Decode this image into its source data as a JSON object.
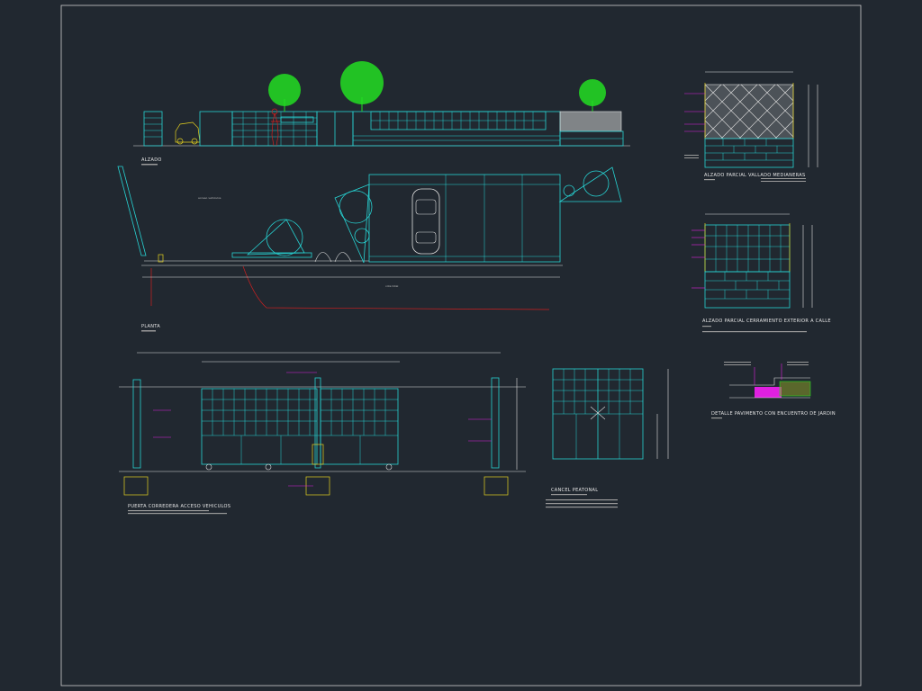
{
  "colors": {
    "background": "#212830",
    "cyan": "#27d3d3",
    "white": "#e0e0e0",
    "magenta": "#e020e0",
    "yellow": "#e6d21e",
    "red": "#d02020",
    "green": "#22dd22"
  },
  "titles": {
    "alzado": "ALZADO",
    "planta": "PLANTA",
    "puerta": "PUERTA CORREDERA ACCESO VEHICULOS",
    "cancel": "CANCEL PEATONAL",
    "vallado": "ALZADO PARCIAL VALLADO MEDIANERAS",
    "cerramiento": "ALZADO PARCIAL CERRAMIENTO EXTERIOR A CALLE",
    "detalle": "DETALLE PAVIMENTO CON ENCUENTRO DE JARDIN"
  }
}
